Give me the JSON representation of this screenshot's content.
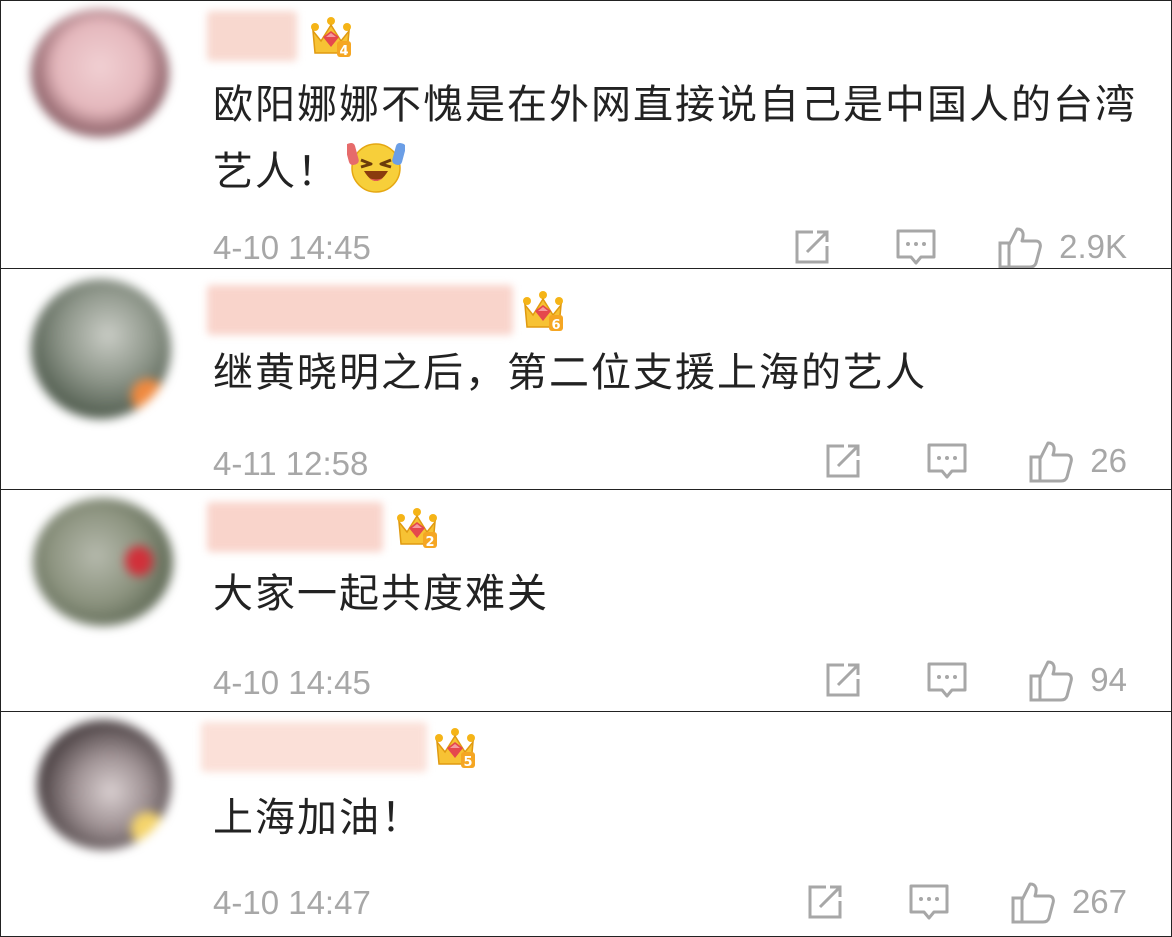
{
  "comments": [
    {
      "vip_level": "4",
      "text": "欧阳娜娜不愧是在外网直接说自己是中国人的台湾艺人！",
      "emoji": "laughing-tears-emoji",
      "time": "4-10 14:45",
      "likes": "2.9K"
    },
    {
      "vip_level": "6",
      "text": "继黄晓明之后，第二位支援上海的艺人",
      "time": "4-11 12:58",
      "likes": "26"
    },
    {
      "vip_level": "2",
      "text": "大家一起共度难关",
      "time": "4-10 14:45",
      "likes": "94"
    },
    {
      "vip_level": "5",
      "text": "上海加油！",
      "time": "4-10 14:47",
      "likes": "267"
    }
  ],
  "icons": {
    "share": "share-icon",
    "reply": "comment-icon",
    "like": "thumbs-up-icon",
    "vip": "vip-crown-icon"
  },
  "colors": {
    "text": "#222222",
    "meta": "#a7a7a7",
    "crown": "#f5b417",
    "gem": "#e5484d"
  }
}
